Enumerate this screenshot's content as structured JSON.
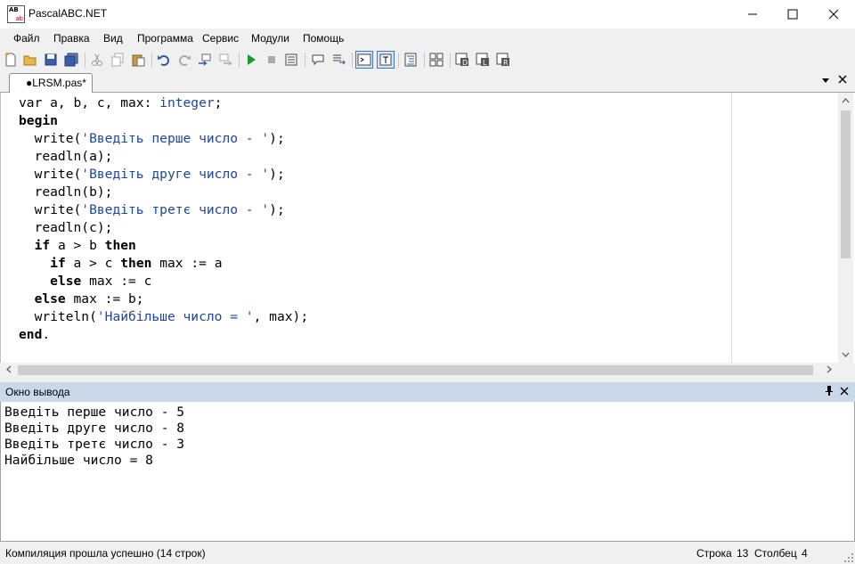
{
  "window": {
    "title": "PascalABC.NET",
    "icon_letters_top": "AB",
    "icon_letters_bottom": "ab",
    "minimize_icon": "minimize-icon",
    "maximize_icon": "maximize-icon",
    "close_icon": "close-icon"
  },
  "menu": [
    "Файл",
    "Правка",
    "Вид",
    "Программа",
    "Сервис",
    "Модули",
    "Помощь"
  ],
  "toolbar_icons": [
    "new-file-icon",
    "open-folder-icon",
    "save-icon",
    "save-all-icon",
    "cut-icon",
    "copy-icon",
    "paste-icon",
    "undo-icon",
    "redo-icon",
    "step-into-icon",
    "step-over-icon",
    "run-icon",
    "stop-icon",
    "compile-icon",
    "comment-icon",
    "uncomment-icon",
    "console-output-icon",
    "text-format-icon",
    "format-code-icon",
    "debug-window-icon",
    "tool-d-icon",
    "tool-l-icon",
    "tool-r-icon"
  ],
  "tab": {
    "label": "●LRSM.pas*"
  },
  "editor": {
    "lines": [
      [
        {
          "t": "var",
          "k": "kw-plain"
        },
        {
          "t": " a, b, c, max: ",
          "k": "plain"
        },
        {
          "t": "integer",
          "k": "typ"
        },
        {
          "t": ";",
          "k": "plain"
        }
      ],
      [
        {
          "t": "begin",
          "k": "kw"
        }
      ],
      [
        {
          "t": "  write(",
          "k": "plain"
        },
        {
          "t": "'Введіть перше число - '",
          "k": "str"
        },
        {
          "t": ");",
          "k": "plain"
        }
      ],
      [
        {
          "t": "  readln(a);",
          "k": "plain"
        }
      ],
      [
        {
          "t": "  write(",
          "k": "plain"
        },
        {
          "t": "'Введіть друге число - '",
          "k": "str"
        },
        {
          "t": ");",
          "k": "plain"
        }
      ],
      [
        {
          "t": "  readln(b);",
          "k": "plain"
        }
      ],
      [
        {
          "t": "  write(",
          "k": "plain"
        },
        {
          "t": "'Введіть третє число - '",
          "k": "str"
        },
        {
          "t": ");",
          "k": "plain"
        }
      ],
      [
        {
          "t": "  readln(c);",
          "k": "plain"
        }
      ],
      [
        {
          "t": "  ",
          "k": "plain"
        },
        {
          "t": "if",
          "k": "kw"
        },
        {
          "t": " a > b ",
          "k": "plain"
        },
        {
          "t": "then",
          "k": "kw"
        }
      ],
      [
        {
          "t": "    ",
          "k": "plain"
        },
        {
          "t": "if",
          "k": "kw"
        },
        {
          "t": " a > c ",
          "k": "plain"
        },
        {
          "t": "then",
          "k": "kw"
        },
        {
          "t": " max := a",
          "k": "plain"
        }
      ],
      [
        {
          "t": "    ",
          "k": "plain"
        },
        {
          "t": "else",
          "k": "kw"
        },
        {
          "t": " max := c",
          "k": "plain"
        }
      ],
      [
        {
          "t": "  ",
          "k": "plain"
        },
        {
          "t": "else",
          "k": "kw"
        },
        {
          "t": " max := b;",
          "k": "plain"
        }
      ],
      [
        {
          "t": "  writeln(",
          "k": "plain"
        },
        {
          "t": "'Найбільше число = '",
          "k": "str"
        },
        {
          "t": ", max);",
          "k": "plain"
        }
      ],
      [
        {
          "t": "end",
          "k": "kw"
        },
        {
          "t": ".",
          "k": "plain"
        }
      ]
    ]
  },
  "output_panel": {
    "title": "Окно вывода",
    "pin_icon": "pin-icon",
    "close_icon": "close-icon",
    "lines": [
      "Введіть перше число - 5",
      "Введіть друге число - 8",
      "Введіть третє число - 3",
      "Найбільше число = 8"
    ]
  },
  "status": {
    "message": "Компиляция прошла успешно (14 строк)",
    "row_label": "Строка",
    "row_value": "13",
    "col_label": "Столбец",
    "col_value": "4"
  },
  "colors": {
    "keyword": "#000000",
    "string": "#1e46a0",
    "panel_header": "#c9d9ea"
  }
}
